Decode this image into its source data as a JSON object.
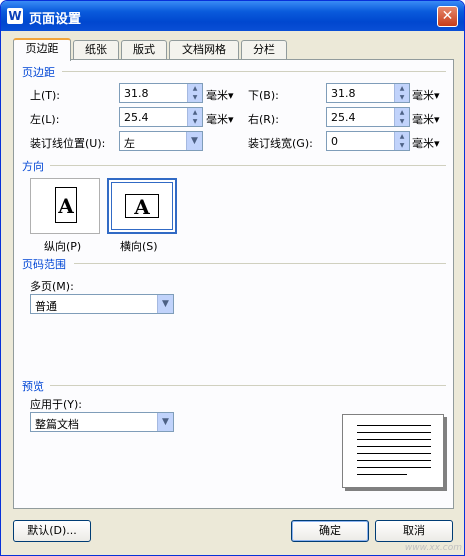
{
  "window": {
    "title": "页面设置",
    "app_icon_glyph": "W",
    "close_glyph": "✕"
  },
  "tabs": [
    {
      "label": "页边距",
      "active": true
    },
    {
      "label": "纸张",
      "active": false
    },
    {
      "label": "版式",
      "active": false
    },
    {
      "label": "文档网格",
      "active": false
    },
    {
      "label": "分栏",
      "active": false
    }
  ],
  "margins": {
    "heading": "页边距",
    "top": {
      "label": "上(T):",
      "value": "31.8",
      "unit": "毫米▾"
    },
    "bottom": {
      "label": "下(B):",
      "value": "31.8",
      "unit": "毫米▾"
    },
    "left": {
      "label": "左(L):",
      "value": "25.4",
      "unit": "毫米▾"
    },
    "right": {
      "label": "右(R):",
      "value": "25.4",
      "unit": "毫米▾"
    },
    "gutter_position": {
      "label": "装订线位置(U):",
      "value": "左"
    },
    "gutter_width": {
      "label": "装订线宽(G):",
      "value": "0",
      "unit": "毫米▾"
    }
  },
  "orientation": {
    "heading": "方向",
    "glyph": "A",
    "portrait_label": "纵向(P)",
    "landscape_label": "横向(S)",
    "selected": "landscape"
  },
  "page_range": {
    "heading": "页码范围",
    "multiple_pages_label": "多页(M):",
    "multiple_pages_value": "普通"
  },
  "preview": {
    "heading": "预览",
    "apply_to_label": "应用于(Y):",
    "apply_to_value": "整篇文档"
  },
  "buttons": {
    "default": "默认(D)...",
    "ok": "确定",
    "cancel": "取消"
  },
  "watermark": "www.xx.com",
  "colors": {
    "title_bar": "#0a5bdc",
    "section_heading": "#0046d5",
    "active_tab_accent": "#f1a53a"
  },
  "icons": [
    "app-icon",
    "close-icon",
    "spin-arrows",
    "dropdown-arrow",
    "portrait-page-icon",
    "landscape-page-icon"
  ]
}
